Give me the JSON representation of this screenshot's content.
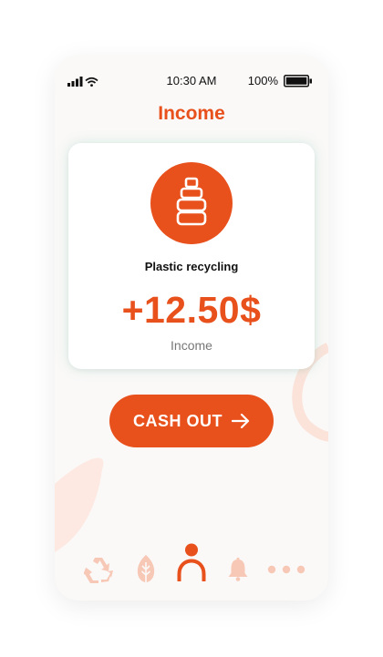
{
  "status_bar": {
    "time": "10:30 AM",
    "battery_percent": "100%",
    "icons": [
      "signal-icon",
      "wifi-icon",
      "battery-icon"
    ]
  },
  "header": {
    "title": "Income"
  },
  "income_card": {
    "icon": "bottle-icon",
    "category": "Plastic recycling",
    "amount": "+12.50$",
    "amount_label": "Income"
  },
  "cash_out": {
    "label": "CASH OUT",
    "icon": "arrow-right-icon"
  },
  "bottom_nav": {
    "items": [
      {
        "icon": "recycle-icon",
        "active": false
      },
      {
        "icon": "leaf-icon",
        "active": false
      },
      {
        "icon": "profile-icon",
        "active": true
      },
      {
        "icon": "bell-icon",
        "active": false
      },
      {
        "icon": "more-icon",
        "active": false
      }
    ]
  },
  "colors": {
    "accent": "#e8501c",
    "accent_muted": "#f7c8b6",
    "background": "#faf9f8",
    "card": "#ffffff"
  }
}
